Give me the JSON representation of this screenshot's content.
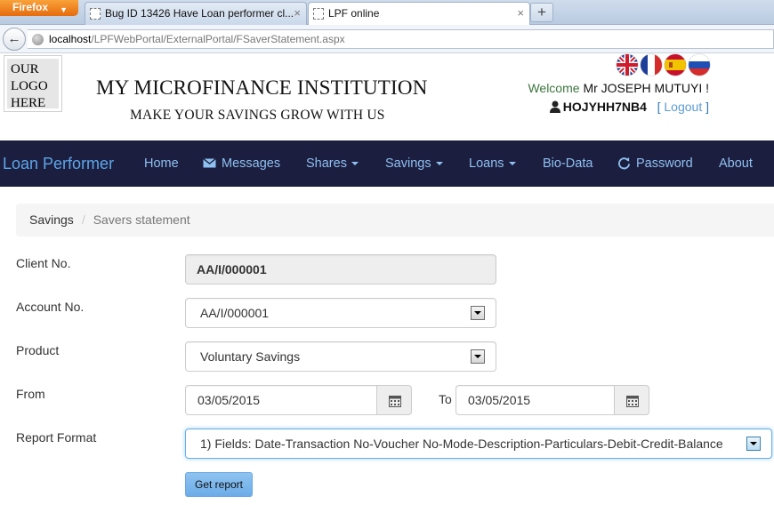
{
  "browser": {
    "app_button": "Firefox",
    "tabs": [
      {
        "title": "Bug ID 13426 Have Loan performer cl...",
        "active": false
      },
      {
        "title": "LPF online",
        "active": true
      }
    ],
    "url_host": "localhost",
    "url_path": "/LPFWebPortal/ExternalPortal/FSaverStatement.aspx"
  },
  "header": {
    "logo_text": "OUR LOGO HERE",
    "institution_name": "MY MICROFINANCE INSTITUTION",
    "slogan": "MAKE YOUR SAVINGS GROW WITH US",
    "languages": [
      "uk-flag-icon",
      "france-flag-icon",
      "spain-flag-icon",
      "russia-flag-icon"
    ],
    "welcome_label": "Welcome",
    "user_name": "Mr JOSEPH MUTUYI !",
    "user_id": "HOJYHH7NB4",
    "bracket_open": "[",
    "logout_label": "Logout",
    "bracket_close": "]"
  },
  "nav": {
    "brand": "Loan Performer",
    "items": [
      {
        "label": "Home"
      },
      {
        "label": "Messages",
        "icon": "envelope-icon"
      },
      {
        "label": "Shares",
        "dropdown": true
      },
      {
        "label": "Savings",
        "dropdown": true
      },
      {
        "label": "Loans",
        "dropdown": true
      },
      {
        "label": "Bio-Data"
      },
      {
        "label": "Password",
        "icon": "refresh-icon"
      },
      {
        "label": "About"
      }
    ]
  },
  "breadcrumb": {
    "parent": "Savings",
    "separator": "/",
    "current": "Savers statement"
  },
  "form": {
    "client_no_label": "Client No.",
    "client_no_value": "AA/I/000001",
    "account_no_label": "Account No.",
    "account_no_value": "AA/I/000001",
    "product_label": "Product",
    "product_value": "Voluntary Savings",
    "from_label": "From",
    "from_value": "03/05/2015",
    "to_label": "To",
    "to_value": "03/05/2015",
    "report_format_label": "Report Format",
    "report_format_value": "1) Fields: Date-Transaction No-Voucher No-Mode-Description-Particulars-Debit-Credit-Balance",
    "get_report_label": "Get report"
  },
  "colors": {
    "navbar_bg": "#1c1e3f",
    "nav_link": "#8ec0f0",
    "brand": "#5ca6e7",
    "welcome_green": "#3c763d"
  }
}
